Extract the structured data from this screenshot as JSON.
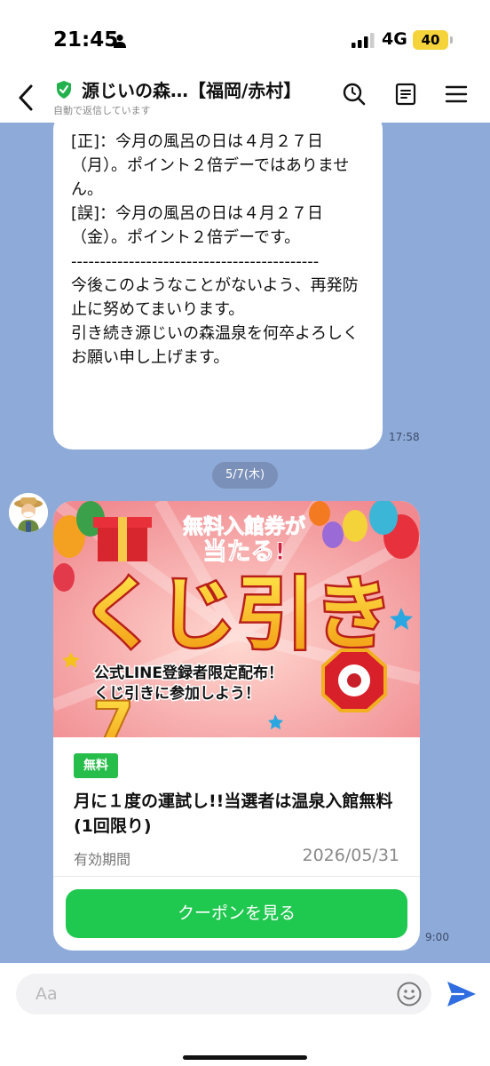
{
  "status": {
    "time": "21:45",
    "network": "4G",
    "battery": "40"
  },
  "header": {
    "title": "源じいの森…【福岡/赤村】",
    "subtitle": "自動で返信しています"
  },
  "message1": {
    "lines": [
      "[正]：今月の風呂の日は４月２７日（月）。ポイント２倍デーではありません。",
      "",
      "[誤]：今月の風呂の日は４月２７日（金）。ポイント２倍デーです。",
      "-------------------------------------------",
      "",
      "今後このようなことがないよう、再発防止に努めてまいります。",
      "",
      "引き続き源じいの森温泉を何卒よろしくお願い申し上げます。"
    ],
    "time": "17:58"
  },
  "date_separator": "5/7(木)",
  "coupon": {
    "banner_top": "無料入館券が",
    "banner_top2": "当たる!",
    "banner_main": "くじ引き",
    "banner_sub1": "公式LINE登録者限定配布！",
    "banner_sub2": "くじ引きに参加しよう！",
    "banner_seven": "7",
    "badge": "無料",
    "title": "月に１度の運試し!!当選者は温泉入館無料(1回限り)",
    "validity_label": "有効期間",
    "validity_date": "2026/05/31",
    "button": "クーポンを見る",
    "time": "9:00"
  },
  "input": {
    "placeholder": "Aa"
  },
  "colors": {
    "line_green": "#1fc84f",
    "chat_bg": "#8eaad8",
    "badge_green": "#27bd4a",
    "send_blue": "#2f6de0"
  },
  "icons": [
    "person-icon",
    "signal-icon",
    "back-chevron-icon",
    "verified-shield-icon",
    "search-icon",
    "notes-icon",
    "menu-icon",
    "emoji-icon",
    "send-icon"
  ]
}
